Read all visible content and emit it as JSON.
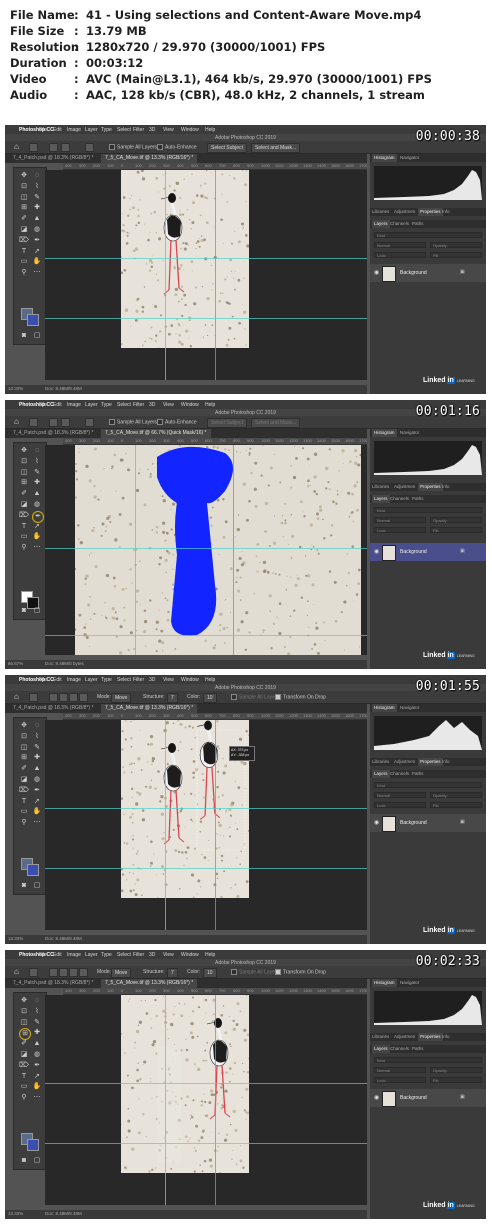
{
  "header": {
    "rows": [
      {
        "key": "File Name",
        "value": "41 - Using selections and Content-Aware Move.mp4"
      },
      {
        "key": "File Size",
        "value": "13.79 MB"
      },
      {
        "key": "Resolution",
        "value": "1280x720 / 29.970 (30000/1001) FPS"
      },
      {
        "key": "Duration",
        "value": "00:03:12"
      },
      {
        "key": "Video",
        "value": "AVC (Main@L3.1), 464 kb/s, 29.970 (30000/1001) FPS"
      },
      {
        "key": "Audio",
        "value": "AAC, 128 kb/s (CBR), 48.0 kHz, 2 channels, 1 stream"
      }
    ],
    "colon": ":"
  },
  "menu": [
    "Photoshop CC",
    "File",
    "Edit",
    "Image",
    "Layer",
    "Type",
    "Select",
    "Filter",
    "3D",
    "View",
    "Window",
    "Help"
  ],
  "app_title": "Adobe Photoshop CC 2019",
  "ruler_labels": [
    "400",
    "300",
    "200",
    "100",
    "0",
    "100",
    "200",
    "300",
    "400",
    "500",
    "600",
    "700",
    "800",
    "900",
    "1000",
    "1100",
    "1200",
    "1300",
    "1400",
    "1500",
    "1600",
    "1700"
  ],
  "panel_tabs_top": {
    "histogram": "Histogram",
    "navigator": "Navigator"
  },
  "panel_tabs_mid": {
    "libraries": "Libraries",
    "adjustments": "Adjustmen",
    "properties": "Properties",
    "info": "Info"
  },
  "panel_tabs_layers": {
    "layers": "Layers",
    "channels": "Channels",
    "paths": "Paths"
  },
  "layer_filter": "Kind",
  "blend_mode": "Normal",
  "opacity_label": "Opacity:",
  "lock_label": "Lock:",
  "fill_label": "Fill:",
  "layer_name": "Background",
  "linkedin": {
    "brand": "Linked",
    "in": "in",
    "learning": "LEARNING"
  },
  "frames": [
    {
      "timestamp": "00:00:38",
      "tabs": [
        "7_4_Patch.psd @ 18.3% (RGB/8*) *",
        "7_5_CA_Move.tif @ 13.3% (RGB/16*) *"
      ],
      "options": {
        "sample_all": "Sample All Layers",
        "auto_enhance": "Auto-Enhance",
        "select_subject": "Select Subject",
        "select_mask": "Select and Mask..."
      },
      "zoom": "13.33%",
      "doc": "Doc: 8.48M/8.48M"
    },
    {
      "timestamp": "00:01:16",
      "tabs": [
        "7_4_Patch.psd @ 18.3% (RGB/8*) *",
        "7_5_CA_Move.tif @ 66.7% (Quick Mask/16) *"
      ],
      "options": {
        "sample_all": "Sample All Layers",
        "auto_enhance": "Auto-Enhance",
        "select_subject": "Select Subject",
        "select_mask": "Select and Mask..."
      },
      "zoom": "66.67%",
      "doc": "Doc: 8.48M/0 bytes"
    },
    {
      "timestamp": "00:01:55",
      "tabs": [
        "7_4_Patch.psd @ 18.3% (RGB/8*) *",
        "7_5_CA_Move.tif @ 13.3% (RGB/16*) *"
      ],
      "options": {
        "mode_label": "Mode:",
        "mode_value": "Move",
        "structure_label": "Structure:",
        "structure_value": "7",
        "color_label": "Color:",
        "color_value": "10",
        "sample_all": "Sample All Layers",
        "transform": "Transform On Drop"
      },
      "tooltip": {
        "line1": "ΔX: 373 px",
        "line2": "ΔY: -328 px"
      },
      "zoom": "13.33%",
      "doc": "Doc: 8.48M/8.48M"
    },
    {
      "timestamp": "00:02:33",
      "tabs": [
        "7_4_Patch.psd @ 18.3% (RGB/8*) *",
        "7_5_CA_Move.tif @ 13.3% (RGB/16*) *"
      ],
      "options": {
        "mode_label": "Mode:",
        "mode_value": "Move",
        "structure_label": "Structure:",
        "structure_value": "7",
        "color_label": "Color:",
        "color_value": "10",
        "sample_all": "Sample All Layers",
        "transform": "Transform On Drop"
      },
      "zoom": "13.33%",
      "doc": "Doc: 8.48M/8.48M"
    }
  ]
}
